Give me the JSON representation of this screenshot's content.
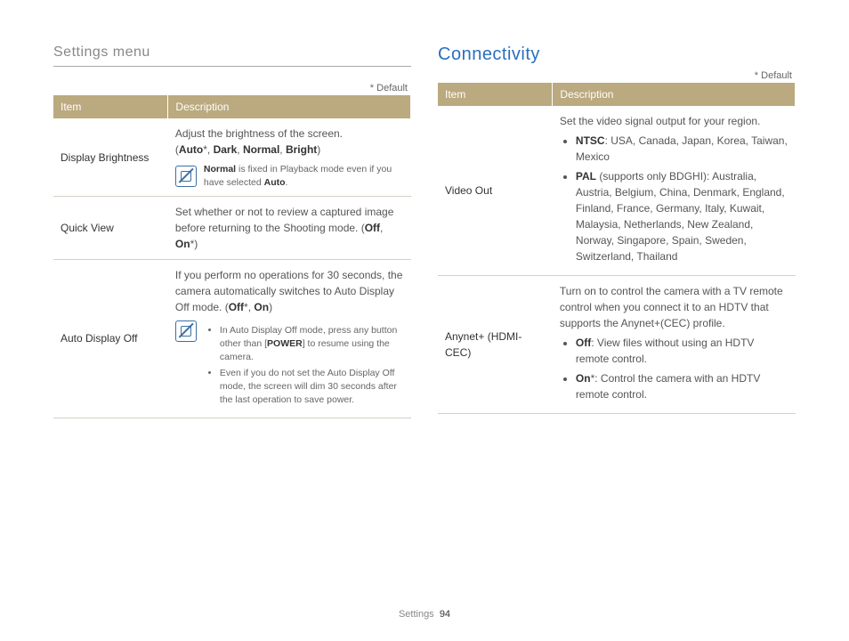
{
  "breadcrumb": "Settings menu",
  "default_marker": "* Default",
  "table_headers": {
    "item": "Item",
    "description": "Description"
  },
  "left_table": {
    "rows": [
      {
        "item": "Display Brightness",
        "desc_intro": "Adjust the brightness of the screen.",
        "options_prefix": "(",
        "opt1": "Auto",
        "sep1": "*, ",
        "opt2": "Dark",
        "sep2": ", ",
        "opt3": "Normal",
        "sep3": ", ",
        "opt4": "Bright",
        "options_suffix": ")",
        "note_b1": "Normal",
        "note_mid": " is fixed in Playback mode even if you have selected ",
        "note_b2": "Auto",
        "note_end": "."
      },
      {
        "item": "Quick View",
        "desc": "Set whether or not to review a captured image before returning to the Shooting mode. (",
        "opt1": "Off",
        "sep1": ", ",
        "opt2": "On",
        "suffix": "*)"
      },
      {
        "item": "Auto Display Off",
        "desc_intro": "If you perform no operations for 30 seconds, the camera automatically switches to Auto Display Off mode. (",
        "opt1": "Off",
        "sep1": "*, ",
        "opt2": "On",
        "suffix": ")",
        "bullet1_a": "In Auto Display Off mode, press any button other than [",
        "bullet1_b": "POWER",
        "bullet1_c": "] to resume using the camera.",
        "bullet2": "Even if you do not set the Auto Display Off mode, the screen will dim 30 seconds after the last operation to save power."
      }
    ]
  },
  "right_section": {
    "title": "Connectivity",
    "rows": [
      {
        "item": "Video Out",
        "intro": "Set the video signal output for your region.",
        "b1_label": "NTSC",
        "b1_text": ": USA, Canada, Japan, Korea, Taiwan, Mexico",
        "b2_label": "PAL",
        "b2_paren": " (supports only BDGHI): ",
        "b2_text": "Australia, Austria, Belgium, China, Denmark, England, Finland, France, Germany, Italy, Kuwait, Malaysia, Netherlands, New Zealand, Norway, Singapore, Spain, Sweden, Switzerland, Thailand"
      },
      {
        "item": "Anynet+ (HDMI-CEC)",
        "intro": "Turn on to control the camera with a TV remote control when you connect it to an HDTV that supports the Anynet+(CEC) profile.",
        "b1_label": "Off",
        "b1_text": ": View files without using an HDTV remote control.",
        "b2_label": "On",
        "b2_star": "*",
        "b2_text": ": Control the camera with an HDTV remote control."
      }
    ]
  },
  "footer": {
    "section": "Settings",
    "page": "94"
  }
}
